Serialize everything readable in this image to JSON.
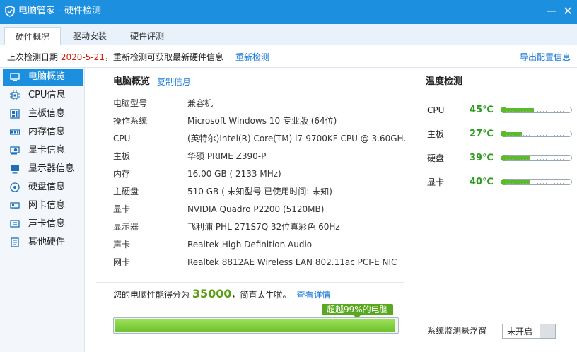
{
  "window": {
    "title": "电脑管家 - 硬件检测",
    "minimize_glyph": "—",
    "close_glyph": "✕",
    "logo_icon": "shield-logo-icon"
  },
  "tabs": [
    {
      "label": "硬件概况",
      "active": true
    },
    {
      "label": "驱动安装",
      "active": false
    },
    {
      "label": "硬件评测",
      "active": false
    }
  ],
  "infobar": {
    "last_detect_label": "上次检测日期",
    "last_detect_date": "2020-5-21",
    "hint": "，重新检测可获取最新硬件信息",
    "redetect": "重新检测",
    "export": "导出配置信息"
  },
  "sidebar": {
    "items": [
      {
        "label": "电脑概览",
        "icon": "monitor-icon",
        "active": true
      },
      {
        "label": "CPU信息",
        "icon": "cpu-icon",
        "active": false
      },
      {
        "label": "主板信息",
        "icon": "motherboard-icon",
        "active": false
      },
      {
        "label": "内存信息",
        "icon": "memory-icon",
        "active": false
      },
      {
        "label": "显卡信息",
        "icon": "graphics-card-icon",
        "active": false
      },
      {
        "label": "显示器信息",
        "icon": "display-icon",
        "active": false
      },
      {
        "label": "硬盘信息",
        "icon": "hard-disk-icon",
        "active": false
      },
      {
        "label": "网卡信息",
        "icon": "network-card-icon",
        "active": false
      },
      {
        "label": "声卡信息",
        "icon": "sound-card-icon",
        "active": false
      },
      {
        "label": "其他硬件",
        "icon": "other-hardware-icon",
        "active": false
      }
    ]
  },
  "overview": {
    "title": "电脑概览",
    "copy": "复制信息",
    "rows": [
      {
        "key": "电脑型号",
        "value": "兼容机"
      },
      {
        "key": "操作系统",
        "value": "Microsoft Windows 10 专业版 (64位)"
      },
      {
        "key": "CPU",
        "value": "(英特尔)Intel(R) Core(TM) i7-9700KF CPU @ 3.60GH..."
      },
      {
        "key": "主板",
        "value": "华硕 PRIME Z390-P"
      },
      {
        "key": "内存",
        "value": "16.00 GB ( 2133 MHz)"
      },
      {
        "key": "主硬盘",
        "value": "510 GB ( 未知型号 已使用时间: 未知)"
      },
      {
        "key": "显卡",
        "value": "NVIDIA Quadro P2200 (5120MB)"
      },
      {
        "key": "显示器",
        "value": "飞利浦 PHL 271S7Q 32位真彩色 60Hz"
      },
      {
        "key": "声卡",
        "value": "Realtek High Definition Audio"
      },
      {
        "key": "网卡",
        "value": "Realtek 8812AE Wireless LAN 802.11ac PCI-E NIC"
      }
    ]
  },
  "score": {
    "prefix": "您的电脑性能得分为",
    "value": "35000",
    "suffix": "，简直太牛啦。",
    "detail": "查看详情",
    "badge": "超越99%的电脑",
    "percent": 99
  },
  "temperature": {
    "title": "温度检测",
    "items": [
      {
        "name": "CPU",
        "value": "45℃"
      },
      {
        "name": "主板",
        "value": "27℃"
      },
      {
        "name": "硬盘",
        "value": "39℃"
      },
      {
        "name": "显卡",
        "value": "40℃"
      }
    ],
    "float_label": "系统监测悬浮窗",
    "toggle_label": "未开启"
  },
  "colors": {
    "accent": "#1d8fdf",
    "date_red": "#d81e06",
    "link": "#1a7ad6",
    "temp_green": "#2e9b22",
    "bar_green": "#6cc02a"
  }
}
